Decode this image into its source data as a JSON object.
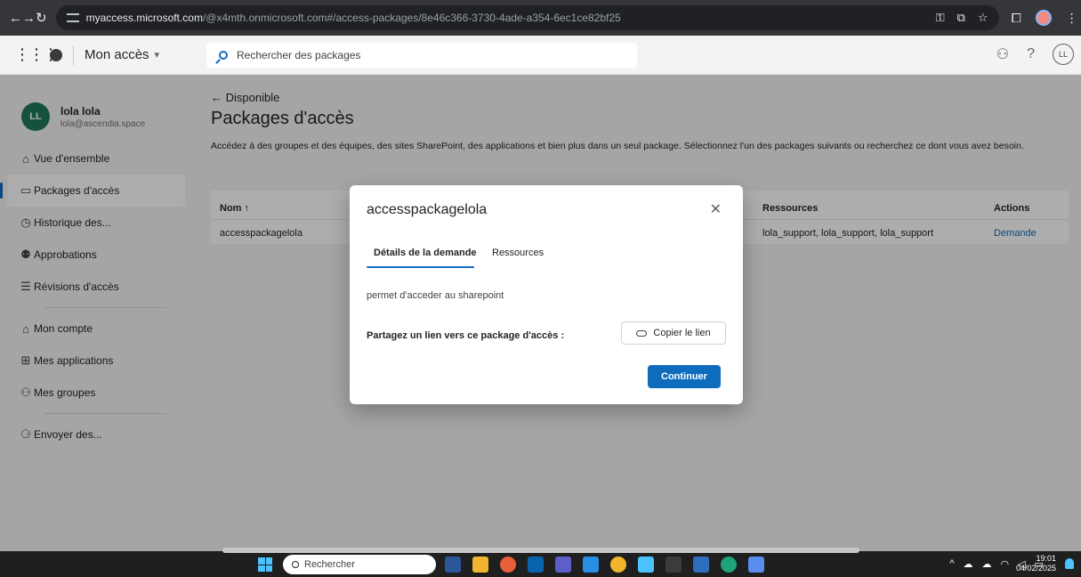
{
  "browser": {
    "url_host": "myaccess.microsoft.com",
    "url_path": "/@x4mth.onmicrosoft.com#/access-packages/8e46c366-3730-4ade-a354-6ec1ce82bf25"
  },
  "header": {
    "app_title": "Mon accès",
    "search_placeholder": "Rechercher des packages",
    "avatar_initials": "LL"
  },
  "user": {
    "initials": "LL",
    "name": "lola lola",
    "email": "lola@ascendia.space"
  },
  "sidebar": {
    "items": [
      {
        "label": "Vue d'ensemble"
      },
      {
        "label": "Packages d'accès"
      },
      {
        "label": "Historique des..."
      },
      {
        "label": "Approbations"
      },
      {
        "label": "Révisions d'accès"
      },
      {
        "label": "Mon compte"
      },
      {
        "label": "Mes applications"
      },
      {
        "label": "Mes groupes"
      },
      {
        "label": "Envoyer des..."
      }
    ]
  },
  "main": {
    "back_label": "Disponible",
    "title": "Packages d'accès",
    "description": "Accédez à des groupes et des équipes, des sites SharePoint, des applications et bien plus dans un seul package. Sélectionnez l'un des packages suivants ou recherchez ce dont vous avez besoin.",
    "table": {
      "headers": {
        "name": "Nom ↑",
        "resources": "Ressources",
        "actions": "Actions"
      },
      "rows": [
        {
          "name": "accesspackagelola",
          "resources": "lola_support, lola_support, lola_support",
          "action": "Demande"
        }
      ]
    }
  },
  "dialog": {
    "title": "accesspackagelola",
    "tabs": [
      "Détails de la demande",
      "Ressources"
    ],
    "description": "permet d'acceder au sharepoint",
    "share_label": "Partagez un lien vers ce package d'accès :",
    "copy_label": "Copier le lien",
    "continue_label": "Continuer"
  },
  "taskbar": {
    "search_placeholder": "Rechercher",
    "time": "19:01",
    "date": "04/02/2025"
  }
}
